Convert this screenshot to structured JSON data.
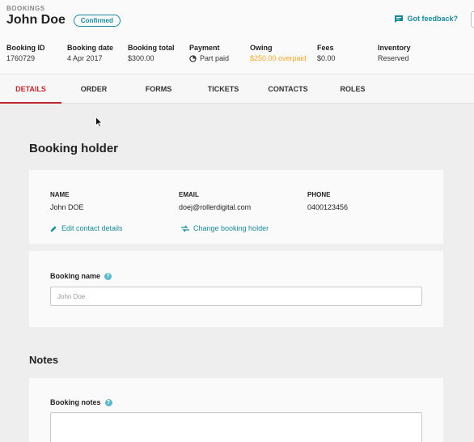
{
  "header": {
    "breadcrumb": "BOOKINGS",
    "title": "John Doe",
    "status": "Confirmed",
    "feedback_label": "Got feedback?"
  },
  "summary": [
    {
      "label": "Booking ID",
      "value": "1760729"
    },
    {
      "label": "Booking date",
      "value": "4 Apr 2017"
    },
    {
      "label": "Booking total",
      "value": "$300.00"
    },
    {
      "label": "Payment",
      "value": "Part paid"
    },
    {
      "label": "Owing",
      "value": "$250.00 overpaid"
    },
    {
      "label": "Fees",
      "value": "$0.00"
    },
    {
      "label": "Inventory",
      "value": "Reserved"
    }
  ],
  "tabs": [
    {
      "label": "DETAILS",
      "active": true
    },
    {
      "label": "ORDER"
    },
    {
      "label": "FORMS"
    },
    {
      "label": "TICKETS"
    },
    {
      "label": "CONTACTS"
    },
    {
      "label": "ROLES"
    }
  ],
  "booking_holder": {
    "section_title": "Booking holder",
    "name_label": "NAME",
    "name_value": "John DOE",
    "email_label": "EMAIL",
    "email_value": "doej@rollerdigital.com",
    "phone_label": "PHONE",
    "phone_value": "0400123456",
    "edit_link": "Edit contact details",
    "change_link": "Change booking holder"
  },
  "booking_name": {
    "label": "Booking name",
    "placeholder": "John Doe"
  },
  "notes": {
    "section_title": "Notes",
    "label": "Booking notes"
  },
  "colors": {
    "accent": "#1a8a9a",
    "active_tab": "#c0262d",
    "overpaid": "#f5a623",
    "background": "#eeeeee"
  },
  "icons": [
    "chat-icon",
    "pie-icon",
    "pencil-icon",
    "swap-icon",
    "help-icon",
    "mouse-cursor-icon"
  ]
}
